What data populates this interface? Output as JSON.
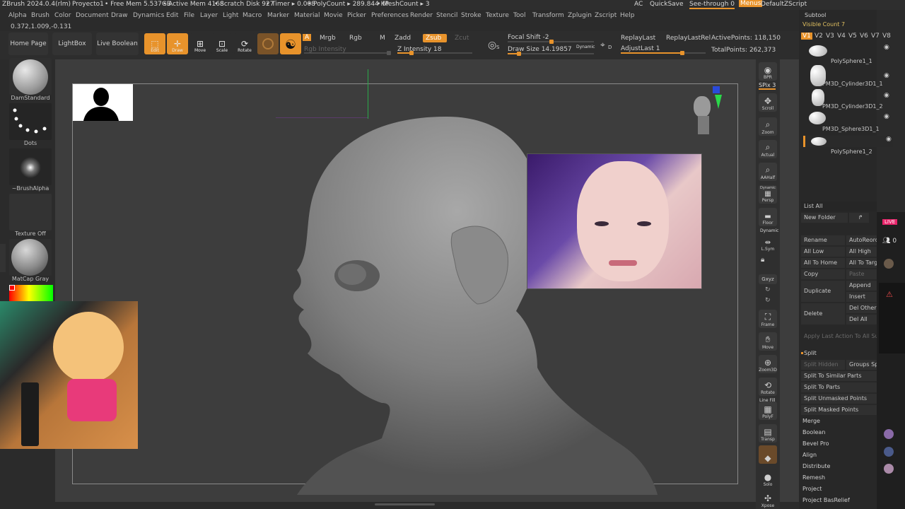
{
  "titlebar": {
    "app": "ZBrush 2024.0.4(rlm)",
    "project": "Proyecto1",
    "free_mem": "• Free Mem 5.537GB",
    "active_mem": "• Active Mem 4168",
    "scratch": "• Scratch Disk 927",
    "timer": "• Timer ▸ 0.008",
    "polycount": "• PolyCount ▸ 289.844 KP",
    "meshcount": "• MeshCount ▸ 3",
    "ac": "AC",
    "quicksave": "QuickSave",
    "seethrough": "See-through  0",
    "menus": "Menus",
    "zscript": "DefaultZScript"
  },
  "menu": [
    "Alpha",
    "Brush",
    "Color",
    "Document",
    "Draw",
    "Dynamics",
    "Edit",
    "File",
    "Layer",
    "Light",
    "Macro",
    "Marker",
    "Material",
    "Movie",
    "Picker",
    "Preferences",
    "Render",
    "Stencil",
    "Stroke",
    "Texture",
    "Tool",
    "Transform",
    "Zplugin",
    "Zscript",
    "Help"
  ],
  "coords": "0.372,1.009,-0.131",
  "shelf": {
    "home": "Home Page",
    "lightbox": "LightBox",
    "liveboolean": "Live Boolean",
    "edit": "Edit",
    "draw": "Draw",
    "move": "Move",
    "scale": "Scale",
    "rotate": "Rotate",
    "a": "A",
    "mrgb": "Mrgb",
    "rgb": "Rgb",
    "m": "M",
    "zadd": "Zadd",
    "zsub": "Zsub",
    "zcut": "Zcut",
    "rgb_intensity": "Rgb Intensity",
    "z_intensity": "Z Intensity 18",
    "focal_shift": "Focal Shift -2",
    "draw_size": "Draw Size 14.19857",
    "dynamic": "Dynamic",
    "replay_last": "ReplayLast",
    "replay_last_rel": "ReplayLastRel",
    "adjust_last": "AdjustLast 1",
    "active_points": "ActivePoints: 118,150",
    "total_points": "TotalPoints: 262,373"
  },
  "left_tray": {
    "brush": "DamStandard",
    "stroke": "Dots",
    "alpha": "~BrushAlpha",
    "texture": "Texture Off",
    "material": "MatCap Gray"
  },
  "right_bar": [
    "BPR",
    "SPix 3",
    "Scroll",
    "Zoom",
    "Actual",
    "AAHalf",
    "Persp",
    "Floor",
    "L.Sym",
    "Gxyz",
    "Frame",
    "Move",
    "Zoom3D",
    "Rotate",
    "PolyF",
    "Transp",
    "Solo",
    "Xpose"
  ],
  "right_bar_extra": {
    "dynamic1": "Dynamic",
    "dynamic2": "Dynamic",
    "linefill": "Line Fill"
  },
  "subtool": {
    "title": "Subtool",
    "visible_count": "Visible Count 7",
    "tabs": [
      "V1",
      "V2",
      "V3",
      "V4",
      "V5",
      "V6",
      "V7",
      "V8"
    ],
    "items": [
      "PolySphere1_1",
      "PM3D_Cylinder3D1_1",
      "PM3D_Cylinder3D1_2",
      "PM3D_Sphere3D1_1",
      "PolySphere1_2"
    ],
    "list_all": "List All",
    "new_folder": "New Folder",
    "rename": "Rename",
    "auto_reorder": "AutoReorder",
    "all_low": "All Low",
    "all_high": "All High",
    "all_to_home": "All To Home",
    "all_to_target": "All To Target",
    "copy": "Copy",
    "paste": "Paste",
    "duplicate": "Duplicate",
    "append": "Append",
    "insert": "Insert",
    "delete": "Delete",
    "del_other": "Del Other",
    "del_all": "Del All",
    "apply_last": "Apply Last Action To All SubTools",
    "split": "Split",
    "split_hidden": "Split Hidden",
    "groups_split": "Groups Split",
    "split_similar": "Split To Similar Parts",
    "split_parts": "Split To Parts",
    "split_unmasked": "Split Unmasked Points",
    "split_masked": "Split Masked Points",
    "merge": "Merge",
    "boolean": "Boolean",
    "bevel_pro": "Bevel Pro",
    "align": "Align",
    "distribute": "Distribute",
    "remesh": "Remesh",
    "project": "Project",
    "project_basrelief": "Project BasRelief"
  },
  "chat": {
    "live": "LIVE",
    "viewers": "0"
  },
  "colors": {
    "accent": "#e8932b",
    "bg": "#2b2b2b",
    "viewport": "#3d3d3d"
  }
}
